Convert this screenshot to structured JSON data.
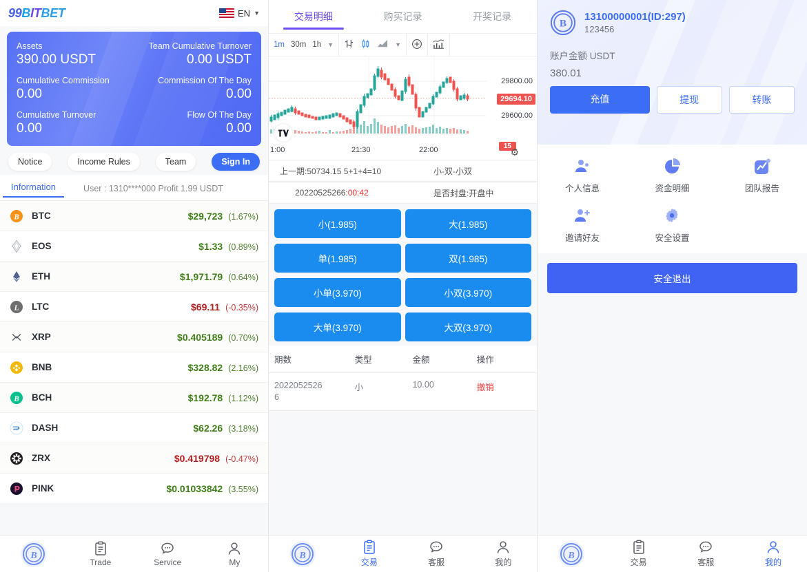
{
  "left": {
    "logo": "99BITBET",
    "lang": "EN",
    "assets": {
      "label_assets": "Assets",
      "value_assets": "390.00 USDT",
      "label_team_turnover": "Team Cumulative Turnover",
      "value_team_turnover": "0.00 USDT",
      "label_cum_commission": "Cumulative Commission",
      "value_cum_commission": "0.00",
      "label_commission_day": "Commission Of The Day",
      "value_commission_day": "0.00",
      "label_cum_turnover": "Cumulative Turnover",
      "value_cum_turnover": "0.00",
      "label_flow_day": "Flow Of The Day",
      "value_flow_day": "0.00"
    },
    "buttons": {
      "notice": "Notice",
      "income_rules": "Income Rules",
      "team": "Team",
      "sign_in": "Sign In"
    },
    "info_tab": "Information",
    "info_user": "User : 1310****000 Profit 1.99 USDT",
    "coins": [
      {
        "symbol": "BTC",
        "icon": "btc-icon",
        "price": "$29,723",
        "change": "(1.67%)",
        "dir": "up"
      },
      {
        "symbol": "EOS",
        "icon": "eos-icon",
        "price": "$1.33",
        "change": "(0.89%)",
        "dir": "up"
      },
      {
        "symbol": "ETH",
        "icon": "eth-icon",
        "price": "$1,971.79",
        "change": "(0.64%)",
        "dir": "up"
      },
      {
        "symbol": "LTC",
        "icon": "ltc-icon",
        "price": "$69.11",
        "change": "(-0.35%)",
        "dir": "down"
      },
      {
        "symbol": "XRP",
        "icon": "xrp-icon",
        "price": "$0.405189",
        "change": "(0.70%)",
        "dir": "up"
      },
      {
        "symbol": "BNB",
        "icon": "bnb-icon",
        "price": "$328.82",
        "change": "(2.16%)",
        "dir": "up"
      },
      {
        "symbol": "BCH",
        "icon": "bch-icon",
        "price": "$192.78",
        "change": "(1.12%)",
        "dir": "up"
      },
      {
        "symbol": "DASH",
        "icon": "dash-icon",
        "price": "$62.26",
        "change": "(3.18%)",
        "dir": "up"
      },
      {
        "symbol": "ZRX",
        "icon": "zrx-icon",
        "price": "$0.419798",
        "change": "(-0.47%)",
        "dir": "down"
      },
      {
        "symbol": "PINK",
        "icon": "pink-icon",
        "price": "$0.01033842",
        "change": "(3.55%)",
        "dir": "up"
      }
    ],
    "tabbar": [
      {
        "label": "",
        "icon": "bitcoin-logo-icon",
        "active": false
      },
      {
        "label": "Trade",
        "icon": "clipboard-icon",
        "active": false
      },
      {
        "label": "Service",
        "icon": "chat-icon",
        "active": false
      },
      {
        "label": "My",
        "icon": "person-icon",
        "active": false
      }
    ]
  },
  "middle": {
    "tabs": [
      {
        "label": "交易明细",
        "active": true
      },
      {
        "label": "购买记录",
        "active": false
      },
      {
        "label": "开奖记录",
        "active": false
      }
    ],
    "toolbar": {
      "intervals": [
        "1m",
        "30m",
        "1h"
      ],
      "selected_interval": "1m",
      "icons": [
        "interval-chevron-icon",
        "bar-chart-type-icon",
        "candlestick-icon",
        "line-chart-icon",
        "chart-type-chevron-icon",
        "plus-indicator-icon",
        "indicators-icon"
      ]
    },
    "chart": {
      "y_labels": [
        "29800.00",
        "29600.00"
      ],
      "live_price": "29694.10",
      "countdown_badge": "15",
      "x_labels": [
        "1:00",
        "21:30",
        "22:00"
      ],
      "gear": "settings-gear-icon",
      "watermark": "tradingview-logo-icon"
    },
    "last_round": {
      "text": "上一期:50734.15 5+1+4=10",
      "result": "小-双-小双"
    },
    "current_round": {
      "issue": "20220525266:",
      "countdown": "00:42",
      "status": "是否封盘:开盘中"
    },
    "bets": [
      "小(1.985)",
      "大(1.985)",
      "单(1.985)",
      "双(1.985)",
      "小单(3.970)",
      "小双(3.970)",
      "大单(3.970)",
      "大双(3.970)"
    ],
    "table": {
      "headers": [
        "期数",
        "类型",
        "金额",
        "操作"
      ],
      "rows": [
        {
          "issue": "20220525266",
          "type": "小",
          "amount": "10.00",
          "action": "撤销"
        }
      ]
    },
    "tabbar": [
      {
        "label": "",
        "icon": "bitcoin-logo-icon",
        "active": false
      },
      {
        "label": "交易",
        "icon": "clipboard-icon",
        "active": true
      },
      {
        "label": "客服",
        "icon": "chat-icon",
        "active": false
      },
      {
        "label": "我的",
        "icon": "person-icon",
        "active": false
      }
    ]
  },
  "right": {
    "account": {
      "name": "13100000001(ID:297)",
      "sub": "123456",
      "balance_label": "账户金额 USDT",
      "balance": "380.01",
      "deposit": "充值",
      "withdraw": "提现",
      "transfer": "转账"
    },
    "menu": [
      {
        "label": "个人信息",
        "icon": "profile-icon"
      },
      {
        "label": "资金明细",
        "icon": "pie-chart-icon"
      },
      {
        "label": "团队报告",
        "icon": "report-trend-icon"
      },
      {
        "label": "邀请好友",
        "icon": "invite-friend-icon"
      },
      {
        "label": "安全设置",
        "icon": "gear-settings-icon"
      }
    ],
    "logout": "安全退出",
    "tabbar": [
      {
        "label": "",
        "icon": "bitcoin-logo-icon",
        "active": false
      },
      {
        "label": "交易",
        "icon": "clipboard-icon",
        "active": false
      },
      {
        "label": "客服",
        "icon": "chat-icon",
        "active": false
      },
      {
        "label": "我的",
        "icon": "person-icon",
        "active": true
      }
    ]
  },
  "colors": {
    "brand_blue": "#3b6ef5",
    "bet_blue": "#1a8cf0",
    "tab_purple": "#6c4df0",
    "up_green": "#3f7d18",
    "down_red": "#b02020",
    "live_red": "#ef5350"
  }
}
